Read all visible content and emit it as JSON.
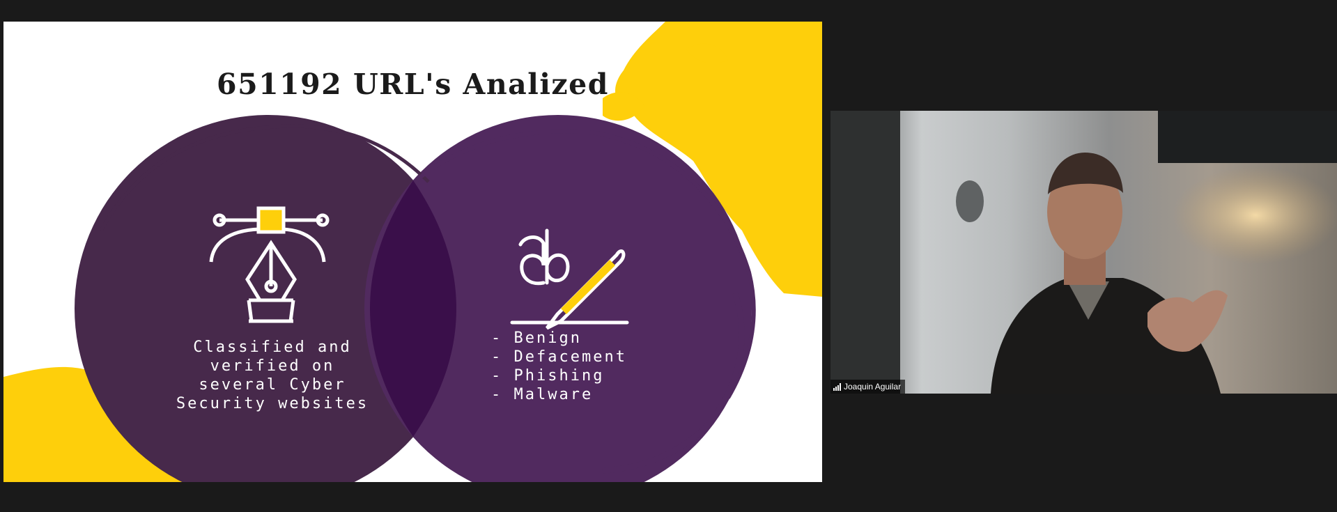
{
  "slide": {
    "title": "651192 URL's Analized",
    "left_circle": {
      "icon": "vector-pen-tool-icon",
      "text": "Classified and verified on several Cyber Security websites"
    },
    "right_circle": {
      "icon": "ab-pencil-icon",
      "items": [
        "- Benign",
        "- Defacement",
        "- Phishing",
        "- Malware"
      ]
    }
  },
  "participant": {
    "name": "Joaquin Aguilar",
    "signal_icon": "signal-strength-icon"
  },
  "colors": {
    "background": "#1a1a1a",
    "slide_bg": "#ffffff",
    "purple_dark": "#47294b",
    "purple_right": "#512a5f",
    "overlap": "#3a0f4a",
    "yellow": "#fecf0b"
  }
}
